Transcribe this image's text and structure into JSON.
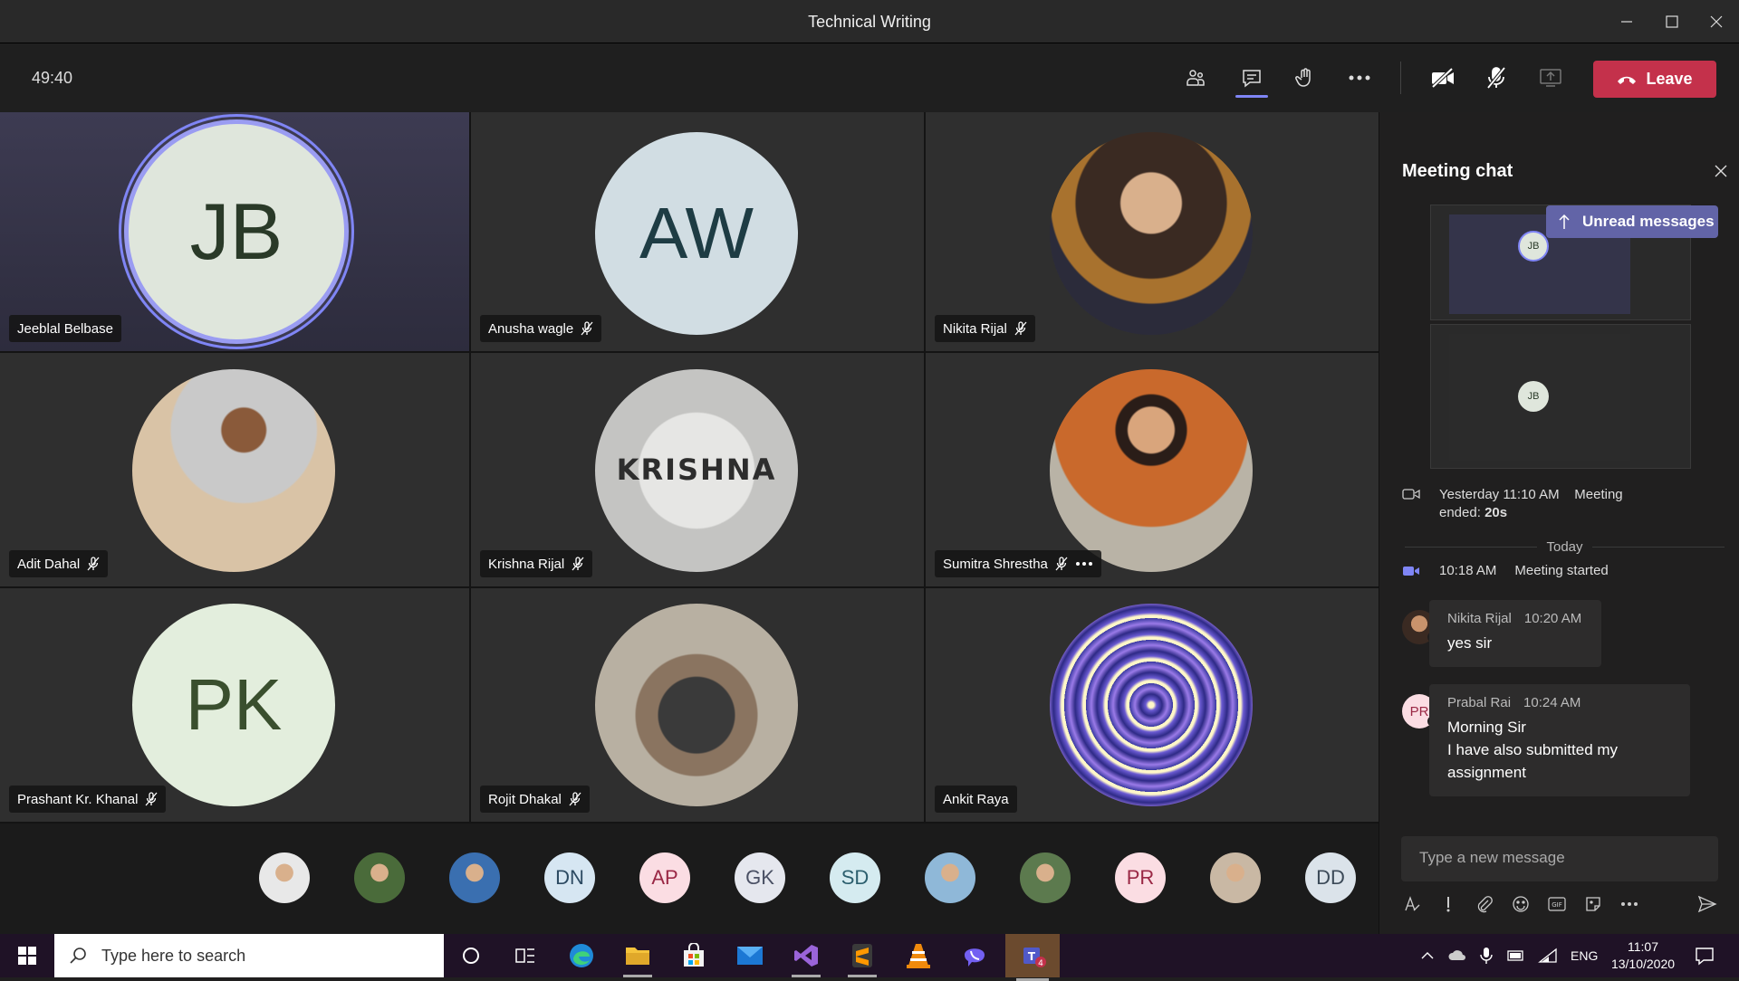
{
  "window": {
    "title": "Technical Writing"
  },
  "toolbar": {
    "timer": "49:40",
    "buttons": [
      "participants-icon",
      "chat-icon",
      "raise-hand-icon",
      "more-options-icon",
      "camera-off-icon",
      "mic-off-icon",
      "share-screen-icon"
    ],
    "leave_label": "Leave",
    "leave_color": "#c4314b"
  },
  "tiles": [
    {
      "name": "Jeeblal Belbase",
      "initials": "JB",
      "bg": "#dfe6dc",
      "fg": "#2a3a28",
      "muted": false,
      "speaking": true
    },
    {
      "name": "Anusha wagle",
      "initials": "AW",
      "bg": "#d1dde3",
      "fg": "#1e3c44",
      "muted": true
    },
    {
      "name": "Nikita Rijal",
      "initials": "",
      "bg": "#6b4a36",
      "fg": "#fff",
      "muted": true
    },
    {
      "name": "Adit Dahal",
      "initials": "",
      "bg": "#c9b89e",
      "fg": "#fff",
      "muted": true
    },
    {
      "name": "Krishna Rijal",
      "initials": "",
      "bg": "#d6d6d4",
      "fg": "#fff",
      "muted": true
    },
    {
      "name": "Sumitra Shrestha",
      "initials": "",
      "bg": "#9c8f7c",
      "fg": "#fff",
      "muted": true,
      "more": true
    },
    {
      "name": "Prashant Kr. Khanal",
      "initials": "PK",
      "bg": "#e3eedd",
      "fg": "#3a4f2e",
      "muted": true
    },
    {
      "name": "Rojit Dhakal",
      "initials": "",
      "bg": "#7c8090",
      "fg": "#fff",
      "muted": true
    },
    {
      "name": "Ankit Raya",
      "initials": "",
      "bg": "#3f3f9a",
      "fg": "#fff",
      "muted": false
    }
  ],
  "strip": [
    {
      "initials": "",
      "bg": "#e8e8e8"
    },
    {
      "initials": "",
      "bg": "#4a6b3a"
    },
    {
      "initials": "",
      "bg": "#3a6fb0"
    },
    {
      "initials": "DN",
      "bg": "#d6e6f2",
      "fg": "#2c4a62"
    },
    {
      "initials": "AP",
      "bg": "#fbdde3",
      "fg": "#9a2845"
    },
    {
      "initials": "GK",
      "bg": "#e5e7ee",
      "fg": "#4a5064"
    },
    {
      "initials": "SD",
      "bg": "#d5ebf0",
      "fg": "#2c5f6e"
    },
    {
      "initials": "",
      "bg": "#8fb8d8"
    },
    {
      "initials": "",
      "bg": "#5c7a4e"
    },
    {
      "initials": "PR",
      "bg": "#fbdde3",
      "fg": "#9a2845"
    },
    {
      "initials": "",
      "bg": "#c9b8a4"
    },
    {
      "initials": "DD",
      "bg": "#dbe3ea",
      "fg": "#3c4a58"
    }
  ],
  "chat": {
    "title": "Meeting chat",
    "unread_label": "Unread messages",
    "thumb_initials": "JB",
    "system1": {
      "time": "Yesterday 11:10 AM",
      "text": "Meeting",
      "text2": "ended:",
      "duration": "20s"
    },
    "today_label": "Today",
    "system2": {
      "time": "10:18 AM",
      "text": "Meeting started"
    },
    "messages": [
      {
        "author": "Nikita Rijal",
        "time": "10:20 AM",
        "text": "yes sir",
        "avatar_initials": ""
      },
      {
        "author": "Prabal Rai",
        "time": "10:24 AM",
        "text": "Morning Sir\n I have also submitted my assignment",
        "avatar_initials": "PR"
      }
    ],
    "compose_placeholder": "Type a new message"
  },
  "taskbar": {
    "search_placeholder": "Type here to search",
    "lang": "ENG",
    "time": "11:07",
    "date": "13/10/2020",
    "teams_badge": "4"
  }
}
